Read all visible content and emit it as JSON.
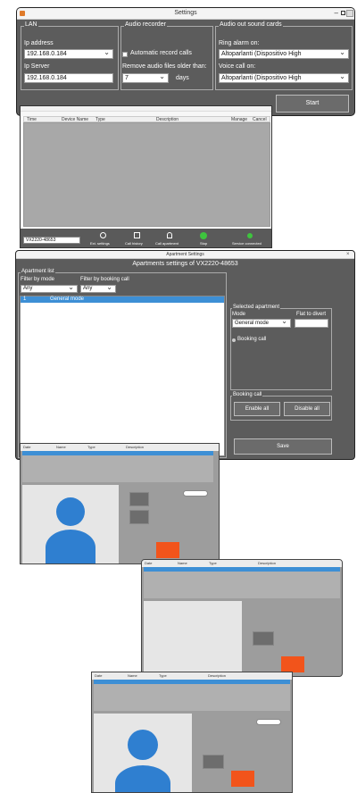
{
  "settings": {
    "title": "Settings",
    "lan": {
      "group": "LAN",
      "ip_address_label": "Ip address",
      "ip_address_value": "192.168.0.184",
      "ip_server_label": "Ip Server",
      "ip_server_value": "192.168.0.184"
    },
    "audio_recorder": {
      "group": "Audio recorder",
      "auto_record_label": "Automatic record calls",
      "remove_label": "Remove audio files older than:",
      "remove_value": "7",
      "remove_unit": "days"
    },
    "audio_out": {
      "group": "Audio out sound cards",
      "ring_label": "Ring alarm on:",
      "ring_value": "Altoparlanti (Dispositivo High",
      "voice_label": "Voice call on:",
      "voice_value": "Altoparlanti (Dispositivo High"
    },
    "start_label": "Start"
  },
  "device_list": {
    "columns": [
      "Time",
      "Device Name",
      "Type",
      "Description",
      "Manage",
      "Cancel"
    ],
    "device_value": "VX2220-48653",
    "toolbar": [
      "Ext. settings",
      "Call history",
      "Call apartment",
      "Stop",
      "Service connected"
    ]
  },
  "apartments": {
    "title": "Apartment Settings",
    "subtitle": "Apartments settings of VX2220-48653",
    "list_group": "Apartment list",
    "filter_mode_label": "Filter by mode",
    "filter_mode_value": "Any",
    "filter_booking_label": "Filter by booking call",
    "filter_booking_value": "Any",
    "rows": [
      {
        "id": "1",
        "mode": "General mode"
      }
    ],
    "selected_group": "Selected apartment",
    "mode_label": "Mode",
    "mode_value": "General mode",
    "flat_label": "Flat to divert",
    "booking_label": "Booking call",
    "booking_group": "Booking call",
    "enable_all": "Enable all",
    "disable_all": "Disable all",
    "save": "Save"
  },
  "call_windows": {
    "columns": [
      "Date",
      "Name",
      "Type",
      "Description"
    ]
  }
}
